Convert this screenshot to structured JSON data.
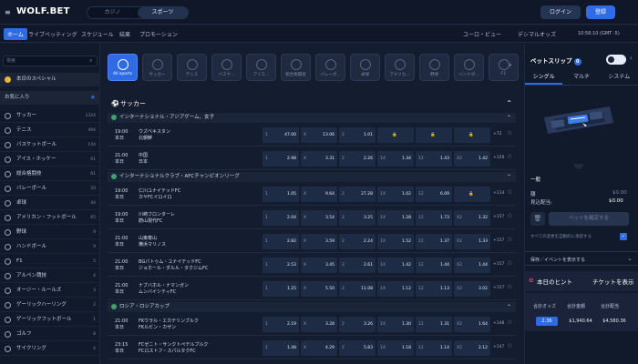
{
  "header": {
    "logo": "WOLF.BET",
    "tabs": [
      "カジノ",
      "スポーツ"
    ],
    "login": "ログイン",
    "register": "登録"
  },
  "nav": {
    "items": [
      "ホーム",
      "ライブベッティング",
      "スケジュール",
      "結果",
      "プロモーション"
    ],
    "odds_view": "ユーロ・ビュー",
    "odds_format": "デシマルオッズ",
    "clock": "10:56:10 (GMT -5)"
  },
  "sidebar": {
    "search_placeholder": "検索",
    "special": "本日のスペシャル",
    "favorites": "お気に入り",
    "sports": [
      {
        "name": "サッカー",
        "count": "1324"
      },
      {
        "name": "テニス",
        "count": "494"
      },
      {
        "name": "バスケットボール",
        "count": "144"
      },
      {
        "name": "アイス・ホッケー",
        "count": "61"
      },
      {
        "name": "総合格闘技",
        "count": "61"
      },
      {
        "name": "バレーボール",
        "count": "20"
      },
      {
        "name": "卓球",
        "count": "44"
      },
      {
        "name": "アメリカン・フットボール",
        "count": "65"
      },
      {
        "name": "野球",
        "count": "9"
      },
      {
        "name": "ハンドボール",
        "count": "9"
      },
      {
        "name": "F1",
        "count": "5"
      },
      {
        "name": "アルペン競技",
        "count": "4"
      },
      {
        "name": "オージー・ルールズ",
        "count": "3"
      },
      {
        "name": "ゲーリックハーリング",
        "count": "2"
      },
      {
        "name": "ゲーリックフットボール",
        "count": "1"
      },
      {
        "name": "ゴルフ",
        "count": "8"
      },
      {
        "name": "サイクリング",
        "count": "4"
      }
    ]
  },
  "main": {
    "tiles": [
      "All sports",
      "サッカー",
      "テニス",
      "バスケ...",
      "アイス...",
      "総合格闘技",
      "バレーボ...",
      "卓球",
      "アメリカ...",
      "野球",
      "ハンドボ...",
      "F1"
    ],
    "section_title": "サッカー",
    "leagues": [
      {
        "name": "インターナショナル・アジアゲーム、女子",
        "matches": [
          {
            "time": "19:00",
            "day": "本日",
            "t1": "ウズベキスタン",
            "t2": "北朝鮮",
            "o": [
              [
                "1",
                "47.00"
              ],
              [
                "X",
                "13.06"
              ],
              [
                "2",
                "1.01"
              ],
              [
                "",
                "lock"
              ],
              [
                "",
                "lock"
              ],
              [
                "",
                "lock"
              ]
            ],
            "more": "+72"
          },
          {
            "time": "21:00",
            "day": "本日",
            "t1": "中国",
            "t2": "日本",
            "o": [
              [
                "1",
                "2.98"
              ],
              [
                "X",
                "3.31"
              ],
              [
                "2",
                "2.26"
              ],
              [
                "1X",
                "1.34"
              ],
              [
                "12",
                "1.43"
              ],
              [
                "X2",
                "1.42"
              ]
            ],
            "more": "+159"
          }
        ]
      },
      {
        "name": "インターナショナルクラブ・AFCチャンピオンリーグ",
        "matches": [
          {
            "time": "19:00",
            "day": "本日",
            "t1": "仁川ユナイテッドFC",
            "t2": "カヤFCイロイロ",
            "o": [
              [
                "1",
                "1.05"
              ],
              [
                "X",
                "9.64"
              ],
              [
                "2",
                "27.28"
              ],
              [
                "1X",
                "1.02"
              ],
              [
                "12",
                "6.09"
              ],
              [
                "",
                "lock"
              ]
            ],
            "more": "+114"
          },
          {
            "time": "19:00",
            "day": "本日",
            "t1": "川崎フロンターレ",
            "t2": "蔚山現代FC",
            "o": [
              [
                "1",
                "2.04"
              ],
              [
                "X",
                "3.54"
              ],
              [
                "2",
                "3.25"
              ],
              [
                "1X",
                "1.28"
              ],
              [
                "12",
                "1.73"
              ],
              [
                "X2",
                "1.32"
              ]
            ],
            "more": "+157"
          },
          {
            "time": "21:00",
            "day": "本日",
            "t1": "山東泰山",
            "t2": "横浜マリノス",
            "o": [
              [
                "1",
                "2.82"
              ],
              [
                "X",
                "3.59"
              ],
              [
                "2",
                "2.24"
              ],
              [
                "1X",
                "1.52"
              ],
              [
                "12",
                "1.37"
              ],
              [
                "X2",
                "1.33"
              ]
            ],
            "more": "+157"
          },
          {
            "time": "21:00",
            "day": "本日",
            "t1": "BGパトゥム・ユナイテッドFC",
            "t2": "ジョホール・ダルル・タクジムFC",
            "o": [
              [
                "1",
                "2.53"
              ],
              [
                "X",
                "3.45"
              ],
              [
                "2",
                "2.61"
              ],
              [
                "1X",
                "1.42"
              ],
              [
                "12",
                "1.44"
              ],
              [
                "X2",
                "1.44"
              ]
            ],
            "more": "+157"
          },
          {
            "time": "21:00",
            "day": "本日",
            "t1": "ナブバホル・ナマンガン",
            "t2": "ムンバイシティFC",
            "o": [
              [
                "1",
                "1.25"
              ],
              [
                "X",
                "5.50"
              ],
              [
                "2",
                "11.08"
              ],
              [
                "1X",
                "1.12"
              ],
              [
                "12",
                "1.13"
              ],
              [
                "X2",
                "3.02"
              ]
            ],
            "more": "+157"
          }
        ]
      },
      {
        "name": "ロシア・ロシアカップ",
        "matches": [
          {
            "time": "21:00",
            "day": "本日",
            "t1": "FKウラル・エカテリンブルク",
            "t2": "FKルビン・カザン",
            "o": [
              [
                "1",
                "2.19"
              ],
              [
                "X",
                "3.28"
              ],
              [
                "2",
                "3.26"
              ],
              [
                "1X",
                "1.30"
              ],
              [
                "12",
                "1.31"
              ],
              [
                "X2",
                "1.64"
              ]
            ],
            "more": "+148"
          },
          {
            "time": "23:15",
            "day": "本日",
            "t1": "FCゼニト・サンクトペテルブルク",
            "t2": "FCロストフ・スパルタクFC",
            "o": [
              [
                "1",
                "1.48"
              ],
              [
                "X",
                "4.29"
              ],
              [
                "2",
                "5.83"
              ],
              [
                "1X",
                "1.18"
              ],
              [
                "12",
                "1.14"
              ],
              [
                "X2",
                "2.12"
              ]
            ],
            "more": "+147"
          }
        ]
      }
    ]
  },
  "betslip": {
    "title": "ベットスリップ",
    "count": "0",
    "tabs": [
      "シングル",
      "マルチ",
      "システム"
    ],
    "single": "一般",
    "stake_label": "額",
    "stake_value": "$0.00",
    "payout_label": "見込配当:",
    "payout_value": "$0.00",
    "place_btn": "ベットを確定する",
    "accept_label": "すべての変更を自動的に承認する",
    "keep_label": "保存／イベントを表示する",
    "hint_tab1": "本日のヒント",
    "hint_tab2": "チケットを表示",
    "table_headers": [
      "合計オッズ",
      "合計金額",
      "合計配当"
    ],
    "table_values": [
      "2.36",
      "$1,940.64",
      "$4,580.36"
    ]
  },
  "colors": {
    "accent": "#2f6be5",
    "bg": "#131c2e"
  }
}
